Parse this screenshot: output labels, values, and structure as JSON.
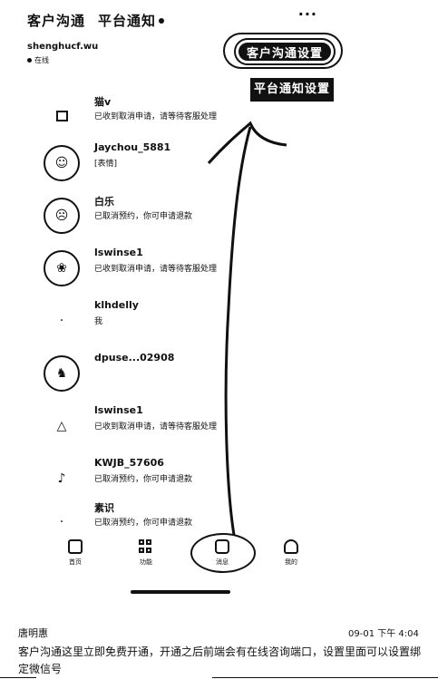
{
  "header": {
    "tab_customer": "客户沟通",
    "tab_platform": "平台通知",
    "more": "···"
  },
  "account": {
    "name": "shenghucf.wu",
    "status": "在线"
  },
  "callouts": {
    "customer_settings": "客户沟通设置",
    "platform_settings": "平台通知设置"
  },
  "conversations": [
    {
      "name": "猫v",
      "tag": "",
      "time": "",
      "preview": "已收到取消申请，请等待客服处理"
    },
    {
      "name": "Jaychou_5881",
      "tag": "",
      "time": "",
      "preview": "[表情]"
    },
    {
      "name": "白乐",
      "tag": "",
      "time": "",
      "preview": "已取消预约，你可申请退款"
    },
    {
      "name": "lswinse1",
      "tag": "",
      "time": "",
      "preview": "已收到取消申请，请等待客服处理"
    },
    {
      "name": "klhdelly",
      "tag": "",
      "time": "",
      "preview": "我"
    },
    {
      "name": "dpuse...02908",
      "tag": "",
      "time": "",
      "preview": ""
    },
    {
      "name": "lswinse1",
      "tag": "",
      "time": "",
      "preview": "已收到取消申请，请等待客服处理"
    },
    {
      "name": "KWJB_57606",
      "tag": "",
      "time": "",
      "preview": "已取消预约，你可申请退款"
    },
    {
      "name": "素识",
      "tag": "",
      "time": "",
      "preview": "已取消预约，你可申请退款"
    }
  ],
  "tabbar": [
    {
      "label": "首页"
    },
    {
      "label": "功能"
    },
    {
      "label": "消息"
    },
    {
      "label": "我的"
    }
  ],
  "message": {
    "sender": "唐明惠",
    "time": "09-01 下午 4:04",
    "body": "客户沟通这里立即免费开通，开通之后前端会有在线咨询端口，设置里面可以设置绑定微信号"
  }
}
